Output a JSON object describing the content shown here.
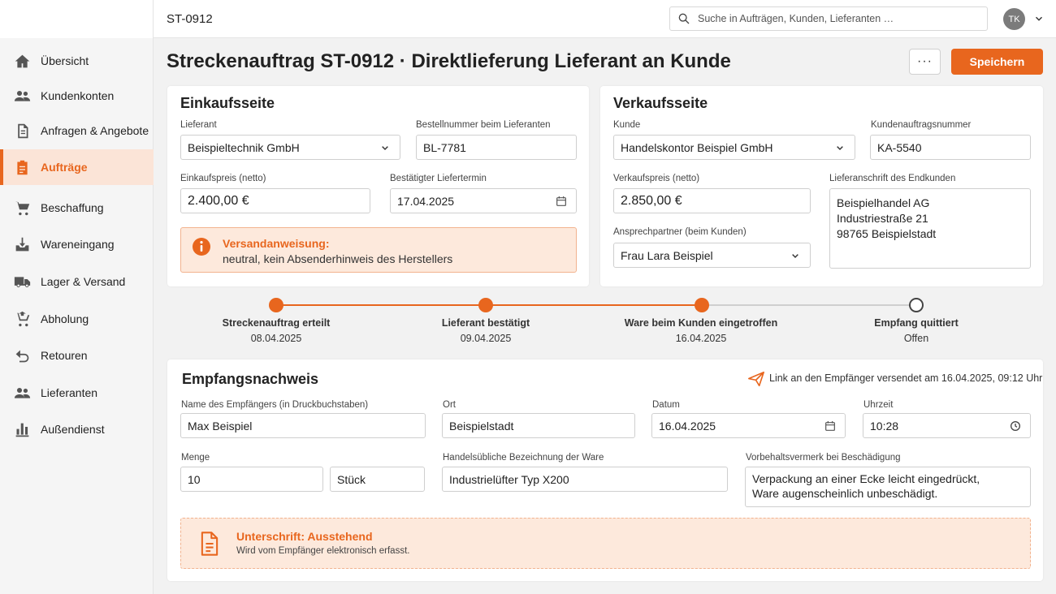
{
  "topbar": {
    "breadcrumb": "ST-0912",
    "search_placeholder": "Suche in Aufträgen, Kunden, Lieferanten …",
    "user_initials": "TK"
  },
  "sidebar": {
    "items": [
      {
        "label": "Übersicht",
        "icon": "home-icon"
      },
      {
        "label": "Kundenkonten",
        "icon": "people-icon"
      },
      {
        "label": "Anfragen & Angebote",
        "icon": "document-icon"
      },
      {
        "label": "Aufträge",
        "icon": "clipboard-icon",
        "active": true
      },
      {
        "label": "Beschaffung",
        "icon": "cart-icon"
      },
      {
        "label": "Wareneingang",
        "icon": "inbox-download-icon"
      },
      {
        "label": "Lager & Versand",
        "icon": "truck-icon"
      },
      {
        "label": "Abholung",
        "icon": "cart-pickup-icon"
      },
      {
        "label": "Retouren",
        "icon": "return-arrow-icon"
      },
      {
        "label": "Lieferanten",
        "icon": "people-icon"
      },
      {
        "label": "Außendienst",
        "icon": "bar-chart-icon"
      }
    ]
  },
  "header": {
    "title": "Streckenauftrag ST-0912 · Direktlieferung Lieferant an Kunde",
    "more_label": "···",
    "save_label": "Speichern"
  },
  "purchase": {
    "title": "Einkaufsseite",
    "supplier_label": "Lieferant",
    "supplier_value": "Beispieltechnik GmbH",
    "order_no_label": "Bestellnummer beim Lieferanten",
    "order_no_value": "BL-7781",
    "price_label": "Einkaufspreis (netto)",
    "price_value": "2.400,00 €",
    "delivery_label": "Bestätigter Liefertermin",
    "delivery_value": "17.04.2025",
    "notice_title": "Versandanweisung:",
    "notice_text": "neutral, kein Absenderhinweis des Herstellers"
  },
  "sales": {
    "title": "Verkaufsseite",
    "customer_label": "Kunde",
    "customer_value": "Handelskontor Beispiel GmbH",
    "customer_order_label": "Kundenauftragsnummer",
    "customer_order_value": "KA-5540",
    "price_label": "Verkaufspreis (netto)",
    "price_value": "2.850,00 €",
    "address_label": "Lieferanschrift des Endkunden",
    "address_line1": "Beispielhandel AG",
    "address_line2": "Industriestraße 21",
    "address_line3": "98765 Beispielstadt",
    "contact_label": "Ansprechpartner (beim Kunden)",
    "contact_value": "Frau Lara Beispiel"
  },
  "timeline": {
    "steps": [
      {
        "label": "Streckenauftrag erteilt",
        "date": "08.04.2025",
        "done": true
      },
      {
        "label": "Lieferant bestätigt",
        "date": "09.04.2025",
        "done": true
      },
      {
        "label": "Ware beim Kunden eingetroffen",
        "date": "16.04.2025",
        "done": true
      },
      {
        "label": "Empfang quittiert",
        "date": "Offen",
        "done": false
      }
    ]
  },
  "receipt": {
    "title": "Empfangsnachweis",
    "link_info": "Link an den Empfänger versendet am 16.04.2025, 09:12 Uhr",
    "name_label": "Name des Empfängers (in Druckbuchstaben)",
    "name_value": "Max Beispiel",
    "city_label": "Ort",
    "city_value": "Beispielstadt",
    "date_label": "Datum",
    "date_value": "16.04.2025",
    "time_label": "Uhrzeit",
    "time_value": "10:28",
    "qty_label": "Menge",
    "qty_value": "10",
    "unit_value": "Stück",
    "goods_label": "Handelsübliche Bezeichnung der Ware",
    "goods_value": "Industrielüfter Typ X200",
    "reservation_label": "Vorbehaltsvermerk bei Beschädigung",
    "reservation_line1": "Verpackung an einer Ecke leicht eingedrückt,",
    "reservation_line2": "Ware augenscheinlich unbeschädigt.",
    "signature_title": "Unterschrift: Ausstehend",
    "signature_text": "Wird vom Empfänger elektronisch erfasst."
  },
  "colors": {
    "accent": "#e8661e",
    "accent_light": "#fde9dc",
    "pending": "#ffffff"
  }
}
